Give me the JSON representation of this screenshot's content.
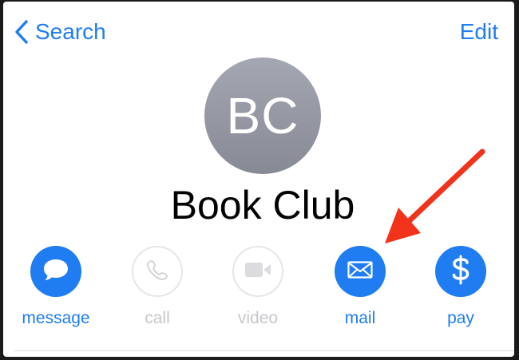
{
  "nav": {
    "back_label": "Search",
    "edit_label": "Edit"
  },
  "contact": {
    "initials": "BC",
    "name": "Book Club"
  },
  "actions": [
    {
      "label": "message",
      "icon": "message-bubble-icon",
      "enabled": true
    },
    {
      "label": "call",
      "icon": "phone-icon",
      "enabled": false
    },
    {
      "label": "video",
      "icon": "video-camera-icon",
      "enabled": false
    },
    {
      "label": "mail",
      "icon": "envelope-icon",
      "enabled": true
    },
    {
      "label": "pay",
      "icon": "dollar-icon",
      "enabled": true
    }
  ],
  "colors": {
    "accent": "#1f7cf1",
    "disabled": "#c7c7cc",
    "avatar": "#8e919c",
    "annotation_arrow": "#f1331b"
  }
}
